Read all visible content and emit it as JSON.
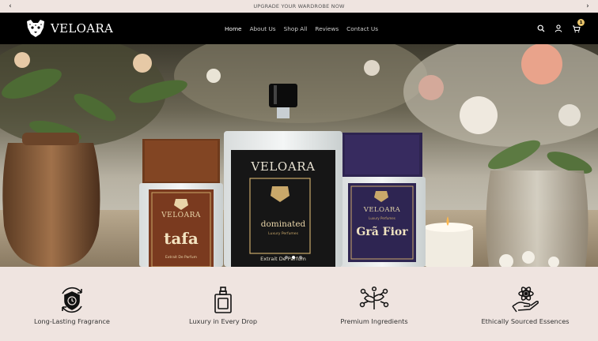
{
  "announcement": {
    "text": "UPGRADE YOUR WARDROBE NOW",
    "prev_icon": "chevron-left-icon",
    "next_icon": "chevron-right-icon"
  },
  "header": {
    "brand": "VELOARA",
    "nav": [
      {
        "label": "Home",
        "active": true
      },
      {
        "label": "About Us",
        "active": false
      },
      {
        "label": "Shop All",
        "active": false
      },
      {
        "label": "Reviews",
        "active": false
      },
      {
        "label": "Contact Us",
        "active": false
      }
    ],
    "cart_count": "1",
    "icons": [
      "search-icon",
      "account-icon",
      "cart-icon"
    ]
  },
  "hero": {
    "bottles": [
      {
        "brand": "VELOARA",
        "name": "tafa",
        "sub": "Extrait De Parfum"
      },
      {
        "brand": "VELOARA",
        "name": "dominated",
        "sub": "Luxury Perfumes",
        "caption": "Extrait De Parfum"
      },
      {
        "brand": "VELOARA",
        "name": "Grã Fior",
        "sub": "Luxury Perfumes"
      }
    ],
    "slides": 3,
    "active_slide": 2
  },
  "features": [
    {
      "label": "Long-Lasting Fragrance",
      "icon": "shield-clock-icon"
    },
    {
      "label": "Luxury in Every Drop",
      "icon": "perfume-bottle-icon"
    },
    {
      "label": "Premium Ingredients",
      "icon": "leaf-molecule-icon"
    },
    {
      "label": "Ethically Sourced Essences",
      "icon": "hand-atom-icon"
    }
  ],
  "colors": {
    "background": "#efe4e0",
    "header": "#000000",
    "badge": "#e9c46a"
  }
}
